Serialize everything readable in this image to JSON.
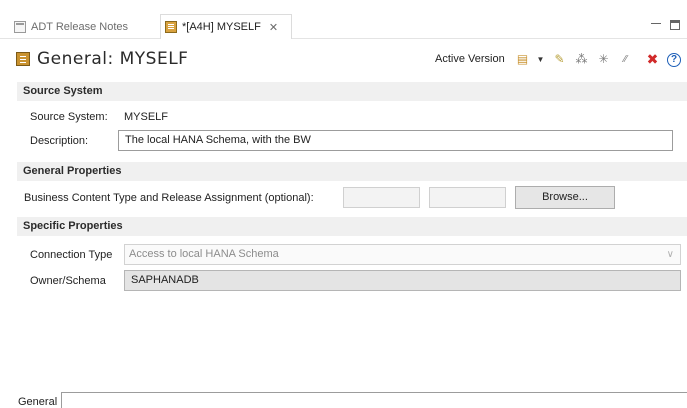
{
  "tabs": [
    {
      "label": "ADT Release Notes"
    },
    {
      "label": "*[A4H] MYSELF",
      "close": "✕"
    }
  ],
  "editor": {
    "title": "General: MYSELF",
    "version": "Active Version"
  },
  "sections": {
    "source_system": "Source System",
    "general_properties": "General Properties",
    "specific_properties": "Specific Properties"
  },
  "fields": {
    "source_system_label": "Source System:",
    "source_system_value": "MYSELF",
    "description_label": "Description:",
    "description_value": "The local HANA Schema, with the BW",
    "bc_label": "Business Content Type and Release Assignment (optional):",
    "browse_button": "Browse...",
    "connection_type_label": "Connection Type",
    "connection_type_value": "Access to local HANA Schema",
    "owner_schema_label": "Owner/Schema",
    "owner_schema_value": "SAPHANADB"
  },
  "bottom_tabs": {
    "general": "General"
  },
  "colors": {
    "section_bg": "#f0f0f0",
    "error_icon": "#d12a2a",
    "help_icon": "#1d5fb8"
  }
}
